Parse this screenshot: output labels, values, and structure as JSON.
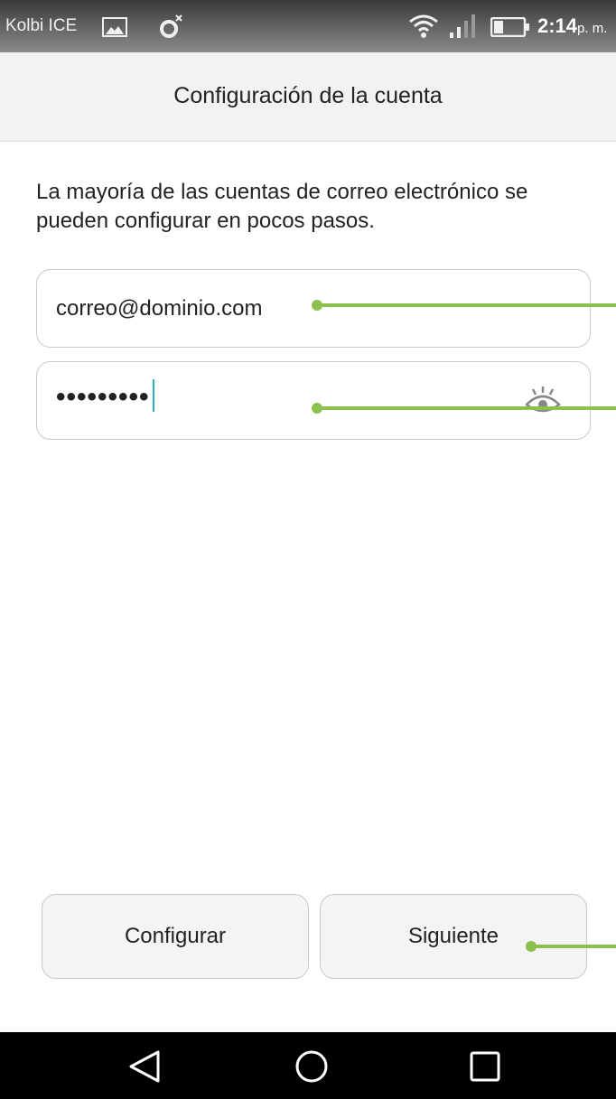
{
  "status_bar": {
    "carrier": "Kolbi ICE",
    "time": "2:14",
    "ampm": "p. m.",
    "icons": [
      "gallery-icon",
      "alarm-icon",
      "wifi-icon",
      "signal-icon",
      "battery-icon"
    ]
  },
  "header": {
    "title": "Configuración de la cuenta"
  },
  "main": {
    "intro": "La mayoría de las cuentas de correo electrónico se pueden configurar en pocos pasos.",
    "email_field": {
      "value": "correo@dominio.com"
    },
    "password_field": {
      "value": "•••••••••",
      "toggle_icon": "eye-icon"
    }
  },
  "buttons": {
    "configure_label": "Configurar",
    "next_label": "Siguiente"
  },
  "nav_bar": {
    "icons": [
      "back-icon",
      "home-icon",
      "recents-icon"
    ]
  },
  "colors": {
    "annotation": "#8dc14f",
    "cursor": "#1fb6c1"
  }
}
